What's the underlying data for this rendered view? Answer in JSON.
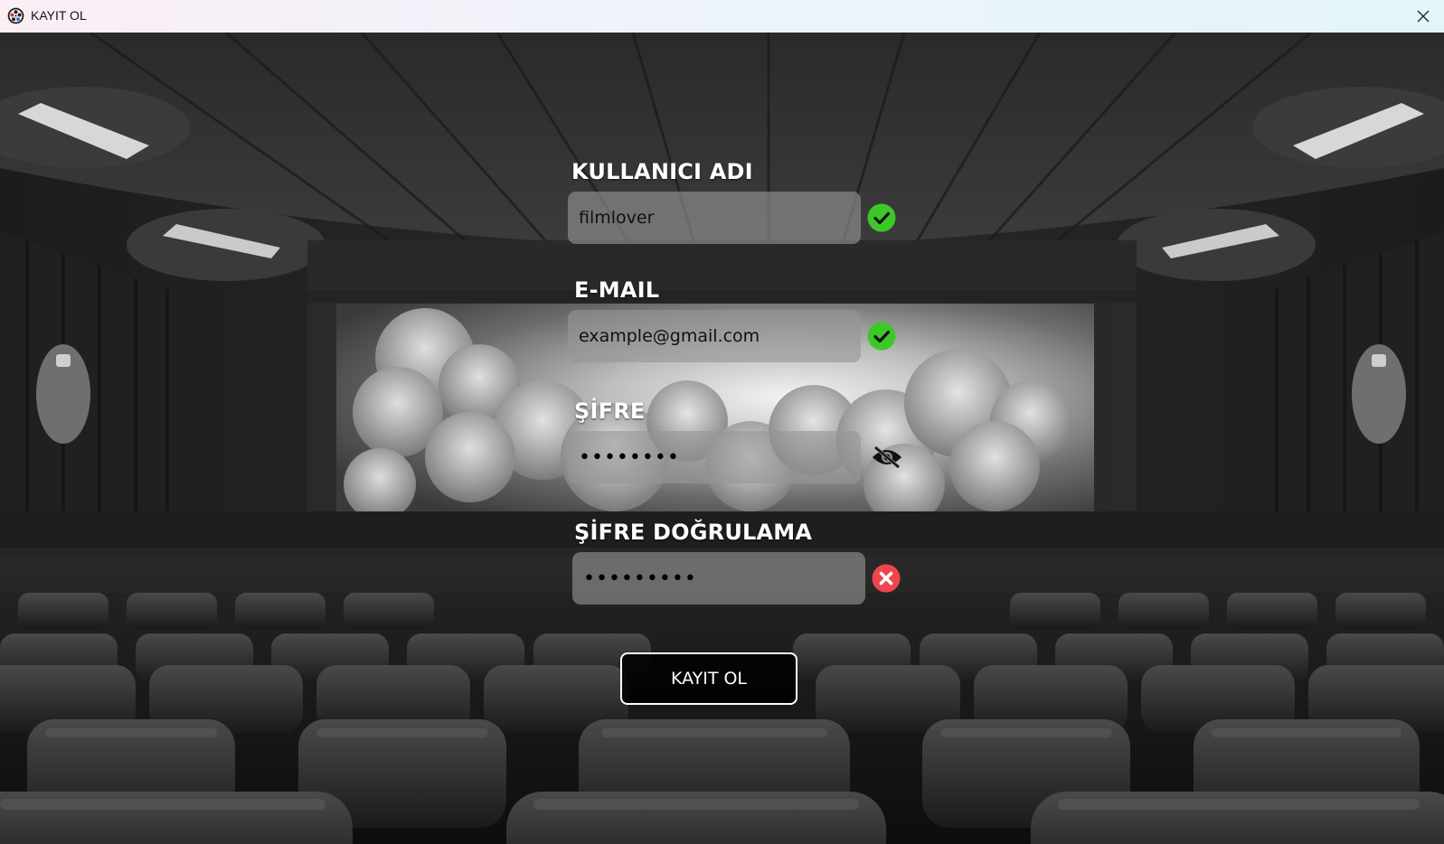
{
  "window": {
    "title": "KAYIT OL",
    "icon": "app-film-reel-icon",
    "close_icon": "close-icon"
  },
  "form": {
    "username": {
      "label": "KULLANICI ADI",
      "value": "filmlover",
      "status": "valid",
      "status_icon": "check-circle-icon"
    },
    "email": {
      "label": "E-MAIL",
      "value": "example@gmail.com",
      "status": "valid",
      "status_icon": "check-circle-icon"
    },
    "password": {
      "label": "ŞİFRE",
      "value": "••••••••",
      "toggle_icon": "eye-slash-icon"
    },
    "password_confirm": {
      "label": "ŞİFRE DOĞRULAMA",
      "value": "•••••••••",
      "status": "invalid",
      "status_icon": "x-circle-icon"
    },
    "submit_label": "KAYIT OL"
  },
  "colors": {
    "valid": "#3cc827",
    "invalid": "#f0454d",
    "label": "#ffffff",
    "field_bg": "rgba(150,150,150,0.62)"
  }
}
